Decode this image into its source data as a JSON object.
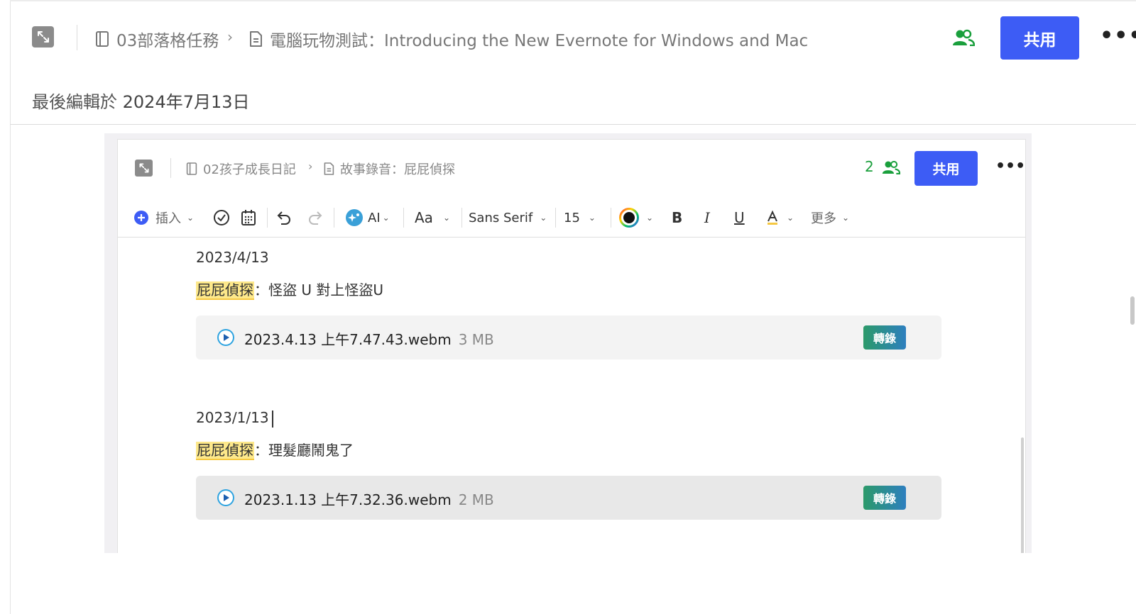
{
  "header": {
    "notebook": "03部落格任務",
    "note_title": "電腦玩物測試：Introducing the New Evernote for Windows and Mac",
    "share_label": "共用",
    "more_label": "•••"
  },
  "edited": {
    "prefix": "最後編輯於 ",
    "date": "2024年7月13日"
  },
  "embed": {
    "notebook": "02孩子成長日記",
    "note_title": "故事錄音：屁屁偵探",
    "collaborator_count": "2",
    "share_label": "共用",
    "more_label": "•••",
    "toolbar": {
      "insert": "插入",
      "ai": "AI",
      "text_style": "Aa",
      "font": "Sans Serif",
      "size": "15",
      "bold": "B",
      "italic": "I",
      "underline": "U",
      "more": "更多"
    },
    "entries": [
      {
        "date": "2023/4/13",
        "tag": "屁屁偵探",
        "text": "：怪盜 U 對上怪盜U",
        "file": "2023.4.13 上午7.47.43.webm",
        "size": "3 MB",
        "action": "轉錄"
      },
      {
        "date": "2023/1/13",
        "tag": "屁屁偵探",
        "text": "：理髮廳鬧鬼了",
        "file": "2023.1.13 上午7.32.36.webm",
        "size": "2 MB",
        "action": "轉錄"
      }
    ]
  },
  "colors": {
    "accent": "#3d5cf5",
    "collab_green": "#1a9f3c",
    "highlight": "#fde88a"
  }
}
